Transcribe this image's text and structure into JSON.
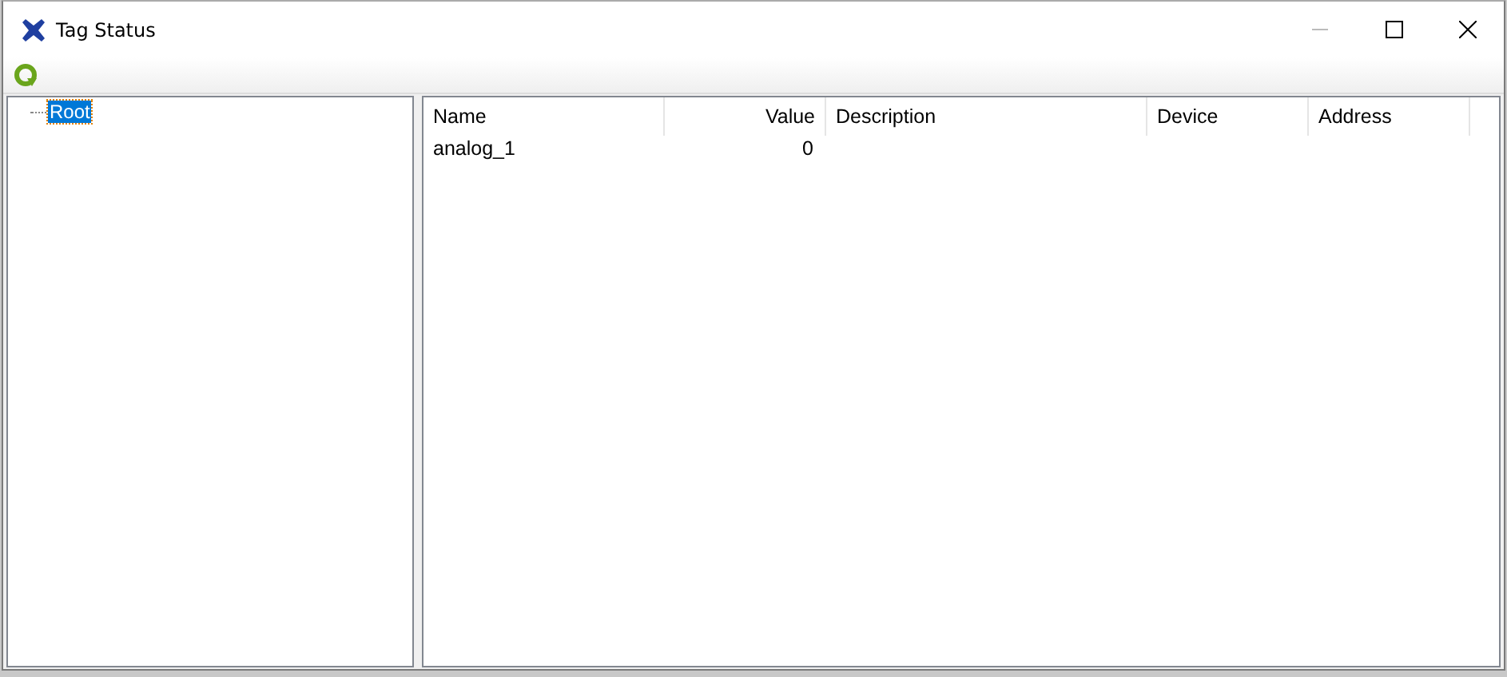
{
  "window": {
    "title": "Tag Status"
  },
  "tree": {
    "items": [
      {
        "label": "Root",
        "selected": true
      }
    ]
  },
  "table": {
    "columns": [
      {
        "label": "Name"
      },
      {
        "label": "Value"
      },
      {
        "label": "Description"
      },
      {
        "label": "Device"
      },
      {
        "label": "Address"
      }
    ],
    "rows": [
      [
        "analog_1",
        "0",
        "",
        "",
        ""
      ]
    ]
  }
}
